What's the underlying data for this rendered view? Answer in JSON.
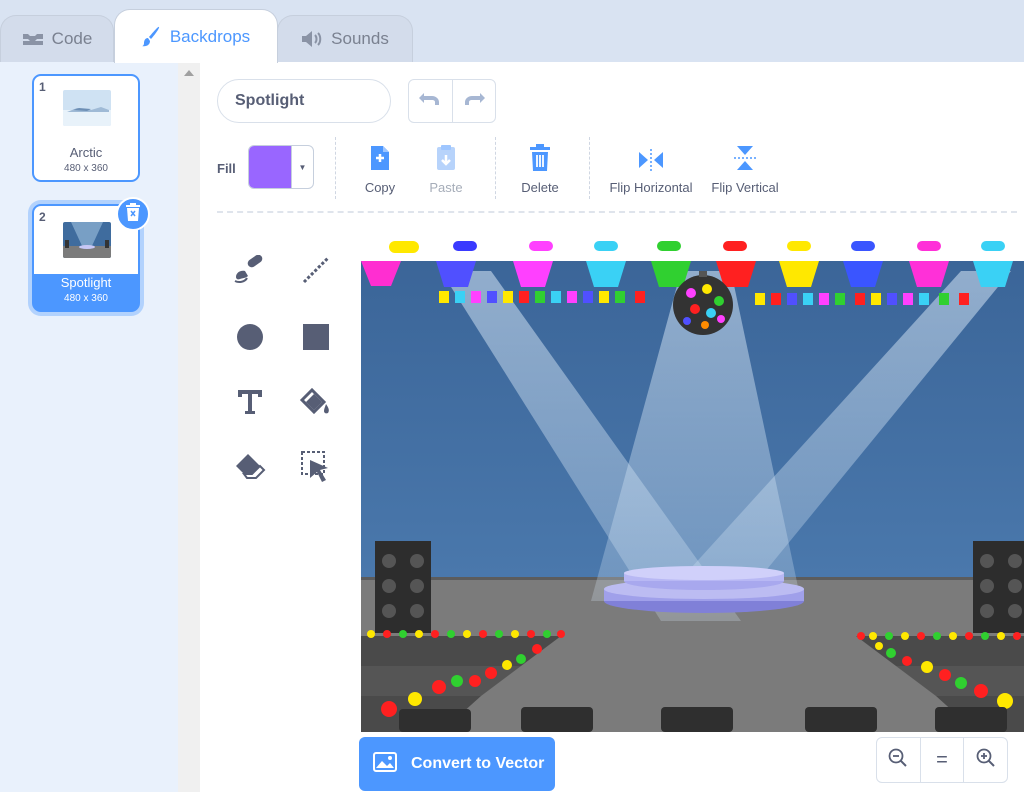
{
  "tabs": [
    {
      "label": "Code",
      "icon": "code-icon"
    },
    {
      "label": "Backdrops",
      "icon": "paintbrush-icon",
      "active": true
    },
    {
      "label": "Sounds",
      "icon": "speaker-icon"
    }
  ],
  "backdrops": [
    {
      "number": "1",
      "name": "Arctic",
      "size": "480 x 360"
    },
    {
      "number": "2",
      "name": "Spotlight",
      "size": "480 x 360",
      "selected": true
    }
  ],
  "editor": {
    "costume_name": "Spotlight",
    "fill_label": "Fill",
    "fill_color": "#9966ff",
    "actions": {
      "copy": "Copy",
      "paste": "Paste",
      "delete": "Delete",
      "flip_h": "Flip Horizontal",
      "flip_v": "Flip Vertical"
    },
    "convert_label": "Convert to Vector",
    "zoom_reset": "="
  },
  "colors": {
    "accent": "#4c97ff",
    "text": "#575e75",
    "stage_wall": "#3f6c9e",
    "stage_floor": "#7b7b7b"
  }
}
